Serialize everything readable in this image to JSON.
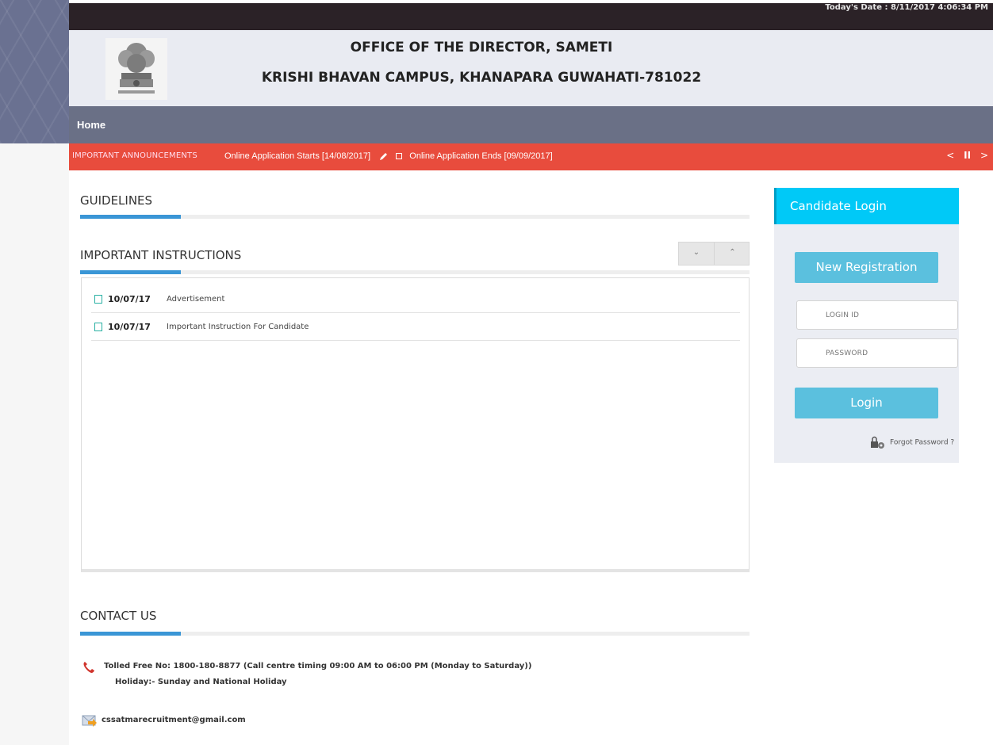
{
  "topbar": {
    "date_label": "Today's Date : 8/11/2017 4:06:34 PM"
  },
  "header": {
    "title_line1": "OFFICE OF THE DIRECTOR, SAMETI",
    "title_line2": "KRISHI BHAVAN CAMPUS, KHANAPARA GUWAHATI-781022",
    "emblem_icon": "national-emblem"
  },
  "nav": {
    "home": "Home"
  },
  "ticker": {
    "label": "IMPORTANT ANNOUNCEMENTS",
    "item1": "Online Application Starts [14/08/2017]",
    "item2": "Online Application Ends [09/09/2017]",
    "prev": "<",
    "pause": "II",
    "next": ">"
  },
  "guidelines": {
    "title": "GUIDELINES"
  },
  "instructions": {
    "title": "IMPORTANT INSTRUCTIONS",
    "expand_icon": "⌄",
    "collapse_icon": "⌃",
    "items": [
      {
        "date": "10/07/17",
        "text": "Advertisement"
      },
      {
        "date": "10/07/17",
        "text": "Important Instruction For Candidate"
      }
    ]
  },
  "contact": {
    "title": "CONTACT US",
    "phone": "Tolled Free No: 1800-180-8877 (Call centre timing 09:00 AM to 06:00 PM (Monday to Saturday))",
    "holiday": "Holiday:- Sunday and National Holiday",
    "email": "cssatmarecruitment@gmail.com"
  },
  "login": {
    "header": "Candidate Login",
    "new_registration": "New Registration",
    "login_id_placeholder": "LOGIN ID",
    "password_placeholder": "PASSWORD",
    "login_button": "Login",
    "forgot": "Forgot Password ?"
  },
  "colors": {
    "ticker_bg": "#e84c3d",
    "nav_bg": "#6a7086",
    "accent_blue": "#3a96d6",
    "login_header": "#00c9f7",
    "button_blue": "#5bc0de"
  }
}
